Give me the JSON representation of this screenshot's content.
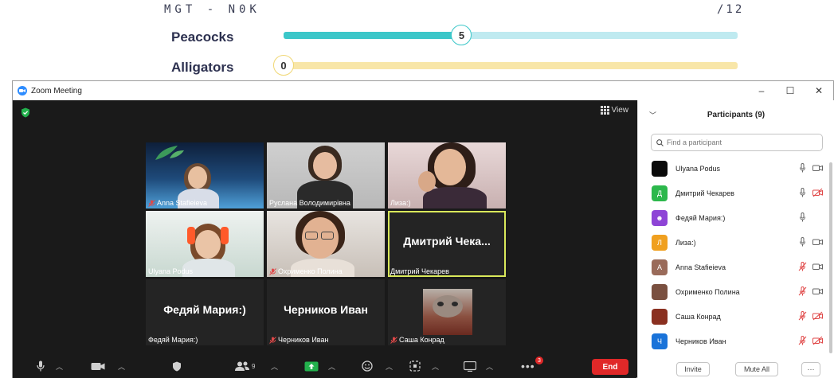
{
  "scoreboard": {
    "title": "MGT - N0K",
    "total": "/12",
    "teams": [
      {
        "name": "Peacocks",
        "score": 5,
        "progress_fraction": 0.392
      },
      {
        "name": "Alligators",
        "score": 0,
        "progress_fraction": 0
      }
    ]
  },
  "window": {
    "title": "Zoom Meeting",
    "minimize": "–",
    "maximize": "☐",
    "close": "✕"
  },
  "video": {
    "view_label": "View",
    "tiles": [
      {
        "label": "Anna Stafieieva",
        "muted": true
      },
      {
        "label": "Руслана Володимирівна",
        "muted": false
      },
      {
        "label": "Лиза:)",
        "muted": false
      },
      {
        "label": "Ulyana Podus",
        "muted": false
      },
      {
        "label": "Охрименко Полина",
        "muted": true
      },
      {
        "label": "Дмитрий Чекарев",
        "big_name": "Дмитрий Чека...",
        "muted": false,
        "active": true
      },
      {
        "label": "Федяй Мария:)",
        "big_name": "Федяй Мария:)",
        "muted": false
      },
      {
        "label": "Черников Иван",
        "big_name": "Черников Иван",
        "muted": true
      },
      {
        "label": "Саша Конрад",
        "muted": true
      }
    ]
  },
  "toolbar": {
    "participants_count": "9",
    "more_badge": "3",
    "end_label": "End"
  },
  "panel": {
    "title": "Participants (9)",
    "search_placeholder": "Find a participant",
    "participants": [
      {
        "name": "Ulyana Podus",
        "avatar_letter": "",
        "avatar_color": "#0a0a0a",
        "mic": "on",
        "video": "on"
      },
      {
        "name": "Дмитрий Чекарев",
        "avatar_letter": "Д",
        "avatar_color": "#2db84c",
        "mic": "on",
        "video": "off"
      },
      {
        "name": "Федяй Мария:)",
        "avatar_letter": "☻",
        "avatar_color": "#8e44d6",
        "mic": "on",
        "video": "none"
      },
      {
        "name": "Лиза:)",
        "avatar_letter": "Л",
        "avatar_color": "#f0a020",
        "mic": "on",
        "video": "on"
      },
      {
        "name": "Anna Stafieieva",
        "avatar_letter": "A",
        "avatar_color": "#9a6b5a",
        "mic": "off",
        "video": "on"
      },
      {
        "name": "Охрименко Полина",
        "avatar_letter": "",
        "avatar_color": "#7a5040",
        "mic": "off",
        "video": "on"
      },
      {
        "name": "Саша Конрад",
        "avatar_letter": "",
        "avatar_color": "#8a3020",
        "mic": "off",
        "video": "off"
      },
      {
        "name": "Черников Иван",
        "avatar_letter": "Ч",
        "avatar_color": "#1a73d9",
        "mic": "off",
        "video": "off"
      }
    ],
    "invite_label": "Invite",
    "mute_all_label": "Mute All",
    "more_label": "···"
  },
  "colors": {
    "peacocks_fill": "#3cc7c9",
    "alligators_fill": "#f0d774",
    "zoom_blue": "#2d8cff",
    "end_red": "#e02828",
    "mute_red": "#e04848"
  }
}
